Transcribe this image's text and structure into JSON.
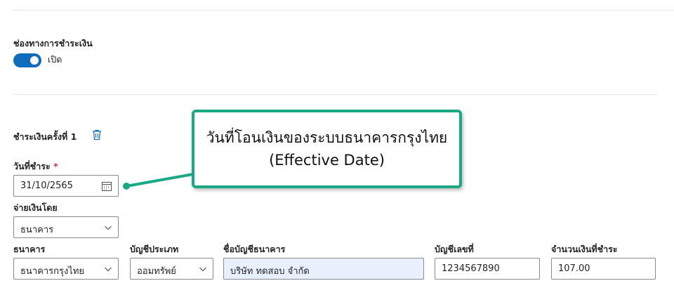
{
  "payment_channel": {
    "label": "ช่องทางการชำระเงิน",
    "toggle_state": "เปิด"
  },
  "installment": {
    "title": "ชำระเงินครั้งที่ 1",
    "date_label": "วันที่ชำระ",
    "required_mark": "*",
    "date_value": "31/10/2565",
    "pay_by_label": "จ่ายเงินโดย",
    "pay_by_value": "ธนาคาร"
  },
  "bank_row": {
    "bank_label": "ธนาคาร",
    "bank_value": "ธนาคารกรุงไทย",
    "account_type_label": "บัญชีประเภท",
    "account_type_value": "ออมทรัพย์",
    "account_name_label": "ชื่อบัญชีธนาคาร",
    "account_name_value": "บริษัท ทดสอบ จำกัด",
    "account_number_label": "บัญชีเลขที่",
    "account_number_value": "1234567890",
    "amount_label": "จำนวนเงินที่ชำระ",
    "amount_value": "107.00"
  },
  "callout": {
    "line1": "วันที่โอนเงินของระบบธนาคารกรุงไทย",
    "line2": "(Effective Date)"
  },
  "colors": {
    "accent": "#0f6cbd",
    "callout_border": "#1aa985",
    "required": "#c4314b",
    "highlight_field": "#e8f0fe"
  }
}
